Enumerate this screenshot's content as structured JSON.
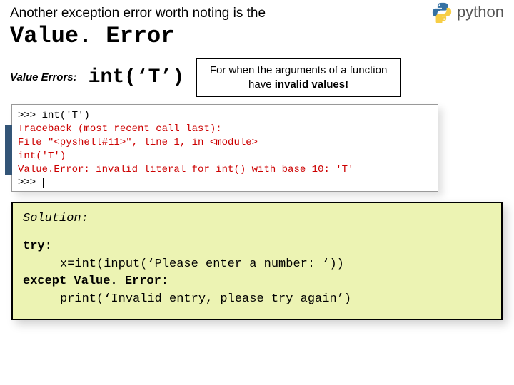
{
  "logo": {
    "text": "python",
    "icon_name": "python-icon"
  },
  "intro": "Another exception error worth noting is the",
  "heading": "Value. Error",
  "row2": {
    "label": "Value Errors:",
    "code": "int(‘T’)",
    "explain_prefix": "For when the arguments of a function have ",
    "explain_bold": "invalid values!"
  },
  "terminal": {
    "l1_prompt": ">>> ",
    "l1_rest": "int('T')",
    "l2": "Traceback (most recent call last):",
    "l3": "  File \"<pyshell#11>\", line 1, in <module>",
    "l4": "    int('T')",
    "l5": "Value.Error: invalid literal for int() with base 10: 'T'",
    "l6_prompt": ">>> "
  },
  "solution": {
    "title": "Solution:",
    "l1_kw": "try",
    "l1_colon": ":",
    "l2": "x=int(input(‘Please enter a number: ‘))",
    "l3_kw1": "except",
    "l3_mid": " ",
    "l3_kw2": "Value. Error",
    "l3_colon": ":",
    "l4": "print(‘Invalid entry, please try again’)"
  }
}
